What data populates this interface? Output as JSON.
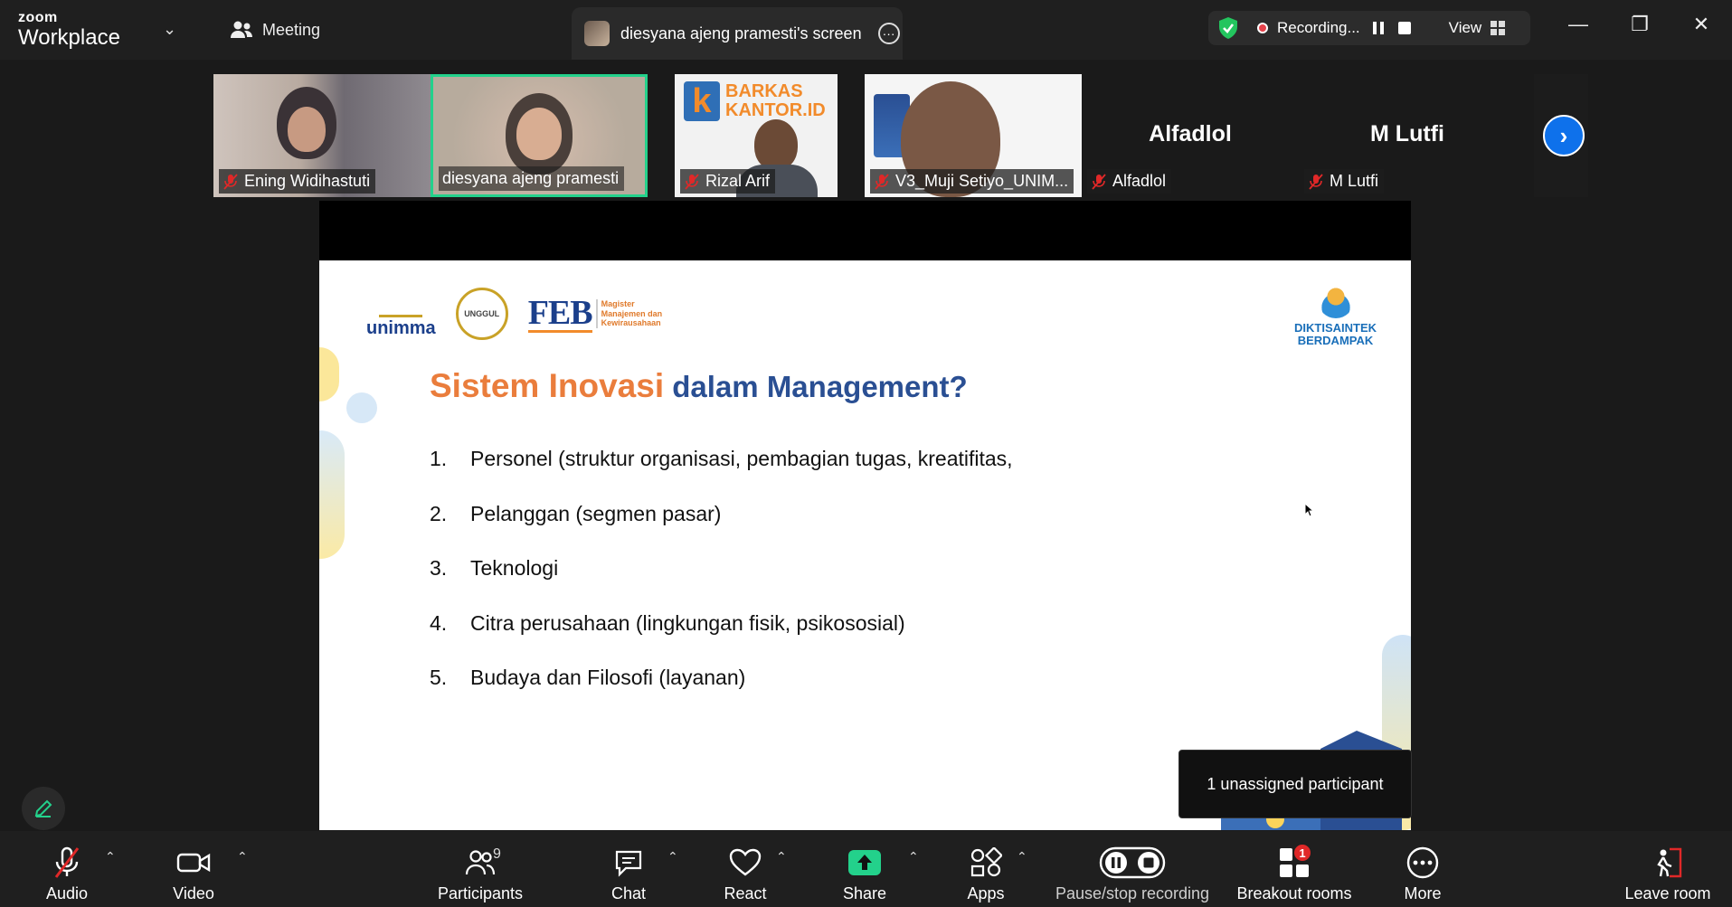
{
  "app": {
    "brand_top": "zoom",
    "brand_bottom": "Workplace"
  },
  "titlebar": {
    "meeting_label": "Meeting",
    "screen_tab_label": "diesyana ajeng pramesti's screen",
    "recording_label": "Recording...",
    "view_label": "View"
  },
  "participants": [
    {
      "name": "Ening Widihastuti",
      "muted": true
    },
    {
      "name": "diesyana ajeng pramesti",
      "muted": false,
      "active_speaker": true
    },
    {
      "name": "Rizal Arif",
      "muted": true
    },
    {
      "name": "V3_Muji Setiyo_UNIM...",
      "muted": true
    },
    {
      "name": "Alfadlol",
      "muted": true,
      "video_off": true
    },
    {
      "name": "M Lutfi",
      "muted": true,
      "video_off": true
    }
  ],
  "tile_logos": {
    "barkas_line1": "BARKAS",
    "barkas_line2": "KANTOR.ID"
  },
  "slide": {
    "logo_unimma": "unimma",
    "logo_seal": "UNGGUL",
    "logo_feb": "FEB",
    "logo_feb_sub": "Magister Manajemen dan Kewirausahaan",
    "logo_dikti_1": "DIKTISAINTEK",
    "logo_dikti_2": "BERDAMPAK",
    "title_part1": "Sistem  Inovasi",
    "title_part2": " dalam Management?",
    "items": [
      {
        "num": "1.",
        "text": "Personel (struktur organisasi, pembagian tugas, kreatifitas,"
      },
      {
        "num": "2.",
        "text": "Pelanggan (segmen pasar)"
      },
      {
        "num": "3.",
        "text": "Teknologi"
      },
      {
        "num": "4.",
        "text": "Citra perusahaan (lingkungan fisik, psikososial)"
      },
      {
        "num": "5.",
        "text": "Budaya dan Filosofi (layanan)"
      }
    ]
  },
  "popup": {
    "text": "1 unassigned participant"
  },
  "toolbar": {
    "audio": "Audio",
    "video": "Video",
    "participants": "Participants",
    "participants_count": "9",
    "chat": "Chat",
    "react": "React",
    "share": "Share",
    "apps": "Apps",
    "pause_stop_recording": "Pause/stop recording",
    "breakout_rooms": "Breakout rooms",
    "breakout_badge": "1",
    "more": "More",
    "leave_room": "Leave room"
  },
  "colors": {
    "accent": "#0e71eb",
    "share_green": "#23d18b",
    "danger": "#e02828",
    "title_orange": "#ea7d3c",
    "title_blue": "#2a4f93"
  }
}
